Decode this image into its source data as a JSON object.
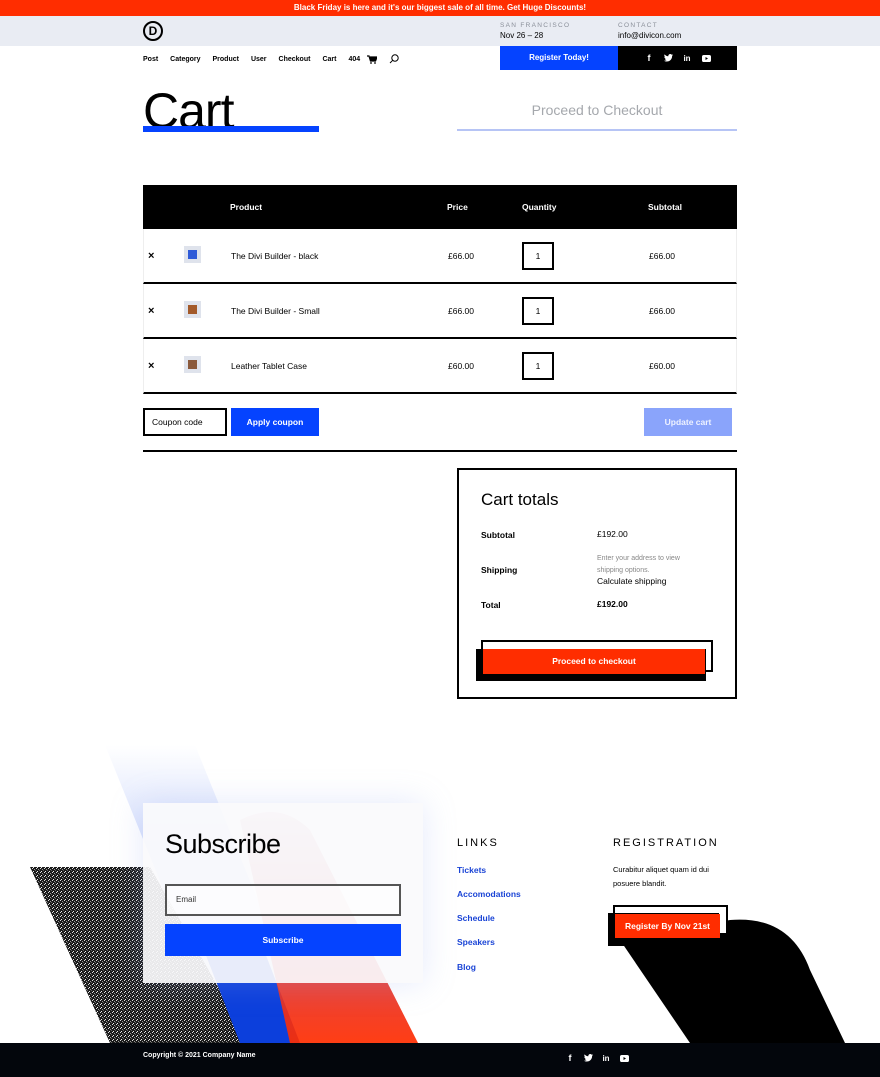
{
  "promo": {
    "text": "Black Friday is here and it's our biggest sale of all time. Get Huge Discounts!"
  },
  "header": {
    "logo_letter": "D",
    "location_label": "SAN FRANCISCO",
    "location_value": "Nov 26 – 28",
    "contact_label": "CONTACT",
    "contact_value": "info@divicon.com",
    "register_label": "Register Today!"
  },
  "nav": {
    "items": [
      "Post",
      "Category",
      "Product",
      "User",
      "Checkout",
      "Cart",
      "404"
    ],
    "icons": [
      "cart-icon",
      "search-icon"
    ]
  },
  "social": [
    "facebook-icon",
    "twitter-icon",
    "linkedin-icon",
    "youtube-icon"
  ],
  "page": {
    "title": "Cart",
    "proceed_tab": "Proceed to Checkout"
  },
  "cart": {
    "headers": {
      "product": "Product",
      "price": "Price",
      "quantity": "Quantity",
      "subtotal": "Subtotal"
    },
    "rows": [
      {
        "remove": "×",
        "name": "The Divi Builder - black",
        "price": "£66.00",
        "qty": "1",
        "subtotal": "£66.00",
        "thumb_color": "#2f5bd8"
      },
      {
        "remove": "×",
        "name": "The Divi Builder - Small",
        "price": "£66.00",
        "qty": "1",
        "subtotal": "£66.00",
        "thumb_color": "#a35a2a"
      },
      {
        "remove": "×",
        "name": "Leather Tablet Case",
        "price": "£60.00",
        "qty": "1",
        "subtotal": "£60.00",
        "thumb_color": "#8b5a3c"
      }
    ],
    "coupon_placeholder": "Coupon code",
    "apply_label": "Apply coupon",
    "update_label": "Update cart"
  },
  "totals": {
    "title": "Cart totals",
    "subtotal_label": "Subtotal",
    "subtotal_value": "£192.00",
    "shipping_label": "Shipping",
    "shipping_note": "Enter your address to view shipping options.",
    "calc_shipping": "Calculate shipping",
    "total_label": "Total",
    "total_value": "£192.00",
    "checkout_label": "Proceed to checkout"
  },
  "subscribe": {
    "title": "Subscribe",
    "email_placeholder": "Email",
    "button_label": "Subscribe"
  },
  "links": {
    "heading": "LINKS",
    "items": [
      "Tickets",
      "Accomodations",
      "Schedule",
      "Speakers",
      "Blog"
    ]
  },
  "registration": {
    "heading": "REGISTRATION",
    "text": "Curabitur aliquet quam id dui posuere blandit.",
    "button_label": "Register By Nov 21st"
  },
  "footer": {
    "copyright": "Copyright © 2021 Company Name"
  },
  "colors": {
    "accent_red": "#ff2d00",
    "accent_blue": "#0543ff",
    "header_bg": "#e9ecf3",
    "link_blue": "#1a44d6"
  }
}
